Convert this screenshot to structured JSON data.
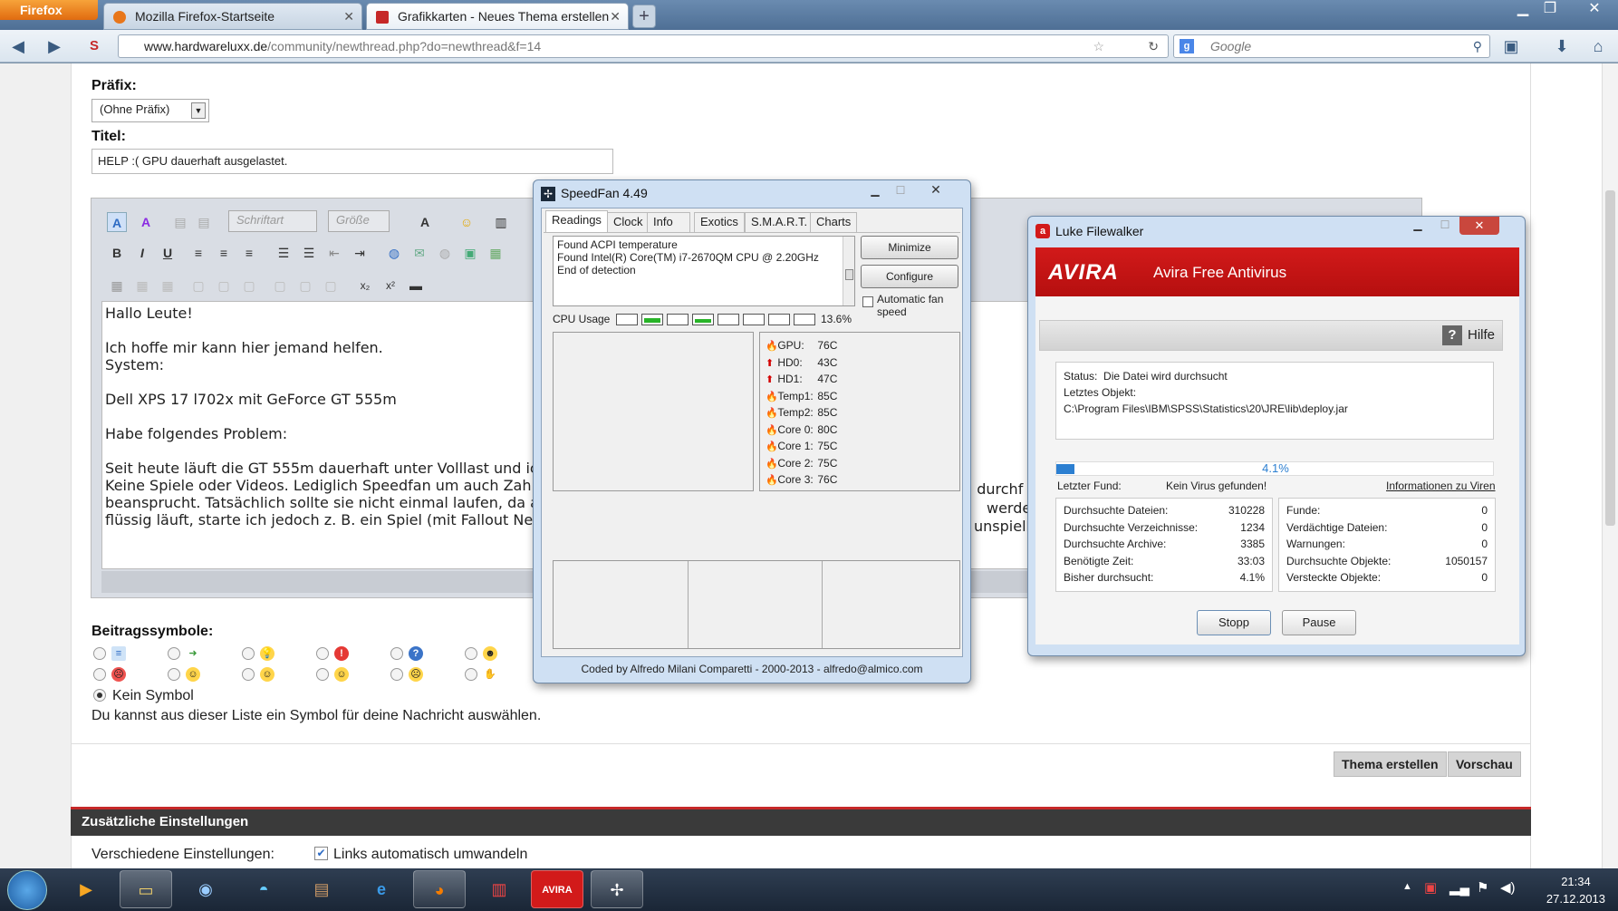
{
  "browser": {
    "menu_label": "Firefox",
    "tabs": [
      {
        "label": "Mozilla Firefox-Startseite"
      },
      {
        "label": "Grafikkarten - Neues Thema erstellen"
      }
    ],
    "url_domain": "www.hardwareluxx.de",
    "url_path": "/community/newthread.php?do=newthread&f=14",
    "search_placeholder": "Google"
  },
  "form": {
    "prefix_label": "Präfix:",
    "prefix_value": "(Ohne Präfix)",
    "title_label": "Titel:",
    "title_value": "HELP :( GPU dauerhaft ausgelastet.",
    "font_placeholder": "Schriftart",
    "size_placeholder": "Größe",
    "body_text": "Hallo Leute!\n\nIch hoffe mir kann hier jemand helfen.\nSystem:\n\nDell XPS 17 l702x mit GeForce GT 555m\n\nHabe folgendes Problem:\n\nSeit heute läuft die GT 555m dauerhaft unter Volllast und ich\nKeine Spiele oder Videos. Lediglich Speedfan um auch Zahlen\nbeansprucht. Tatsächlich sollte sie nicht einmal laufen, da alle\nflüssig läuft, starte ich jedoch z. B. ein Spiel (mit Fallout New",
    "body_right_fragments": [
      "n durchf",
      "werden s",
      "unspielb"
    ],
    "symbols_label": "Beitragssymbole:",
    "no_symbol_label": "Kein Symbol",
    "symbols_hint": "Du kannst aus dieser Liste ein Symbol für deine Nachricht auswählen.",
    "create_button": "Thema erstellen",
    "preview_button": "Vorschau",
    "extra_section": "Zusätzliche Einstellungen",
    "misc_label": "Verschiedene Einstellungen:",
    "autolink_label": "Links automatisch umwandeln"
  },
  "speedfan": {
    "title": "SpeedFan 4.49",
    "tabs": [
      "Readings",
      "Clock",
      "Info",
      "Exotics",
      "S.M.A.R.T.",
      "Charts"
    ],
    "log": "Found ACPI temperature\nFound Intel(R) Core(TM) i7-2670QM CPU @ 2.20GHz\nEnd of detection",
    "minimize_label": "Minimize",
    "configure_label": "Configure",
    "auto_fan_label": "Automatic fan speed",
    "cpu_usage_label": "CPU Usage",
    "cpu_usage_value": "13.6%",
    "cpu_core_levels": [
      0,
      0.6,
      0,
      0.4,
      0,
      0,
      0,
      0
    ],
    "readings": [
      {
        "name": "GPU:",
        "value": "76C",
        "icon": "flame-icon"
      },
      {
        "name": "HD0:",
        "value": "43C",
        "icon": "arrow-up-icon"
      },
      {
        "name": "HD1:",
        "value": "47C",
        "icon": "arrow-up-icon"
      },
      {
        "name": "Temp1:",
        "value": "85C",
        "icon": "flame-icon"
      },
      {
        "name": "Temp2:",
        "value": "85C",
        "icon": "flame-icon"
      },
      {
        "name": "Core 0:",
        "value": "80C",
        "icon": "flame-icon"
      },
      {
        "name": "Core 1:",
        "value": "75C",
        "icon": "flame-icon"
      },
      {
        "name": "Core 2:",
        "value": "75C",
        "icon": "flame-icon"
      },
      {
        "name": "Core 3:",
        "value": "76C",
        "icon": "flame-icon"
      }
    ],
    "footer": "Coded by Alfredo Milani Comparetti - 2000-2013 - alfredo@almico.com"
  },
  "avira": {
    "window_title": "Luke Filewalker",
    "logo": "AVIRA",
    "product": "Avira Free Antivirus",
    "help_label": "Hilfe",
    "status_label": "Status:",
    "status_value": "Die Datei wird durchsucht",
    "last_object_label": "Letztes Objekt:",
    "last_object_value": "C:\\Program Files\\IBM\\SPSS\\Statistics\\20\\JRE\\lib\\deploy.jar",
    "progress": 0.041,
    "progress_text": "4.1%",
    "last_find_label": "Letzter Fund:",
    "last_find_value": "Kein Virus gefunden!",
    "virus_info_link": "Informationen zu Viren",
    "left_stats": [
      {
        "label": "Durchsuchte Dateien:",
        "value": "310228"
      },
      {
        "label": "Durchsuchte Verzeichnisse:",
        "value": "1234"
      },
      {
        "label": "Durchsuchte Archive:",
        "value": "3385"
      },
      {
        "label": "Benötigte Zeit:",
        "value": "33:03"
      },
      {
        "label": "Bisher durchsucht:",
        "value": "4.1%"
      }
    ],
    "right_stats": [
      {
        "label": "Funde:",
        "value": "0"
      },
      {
        "label": "Verdächtige Dateien:",
        "value": "0"
      },
      {
        "label": "Warnungen:",
        "value": "0"
      },
      {
        "label": "Durchsuchte Objekte:",
        "value": "1050157"
      },
      {
        "label": "Versteckte Objekte:",
        "value": "0"
      }
    ],
    "stop_label": "Stopp",
    "pause_label": "Pause"
  },
  "taskbar": {
    "time": "21:34",
    "date": "27.12.2013"
  }
}
